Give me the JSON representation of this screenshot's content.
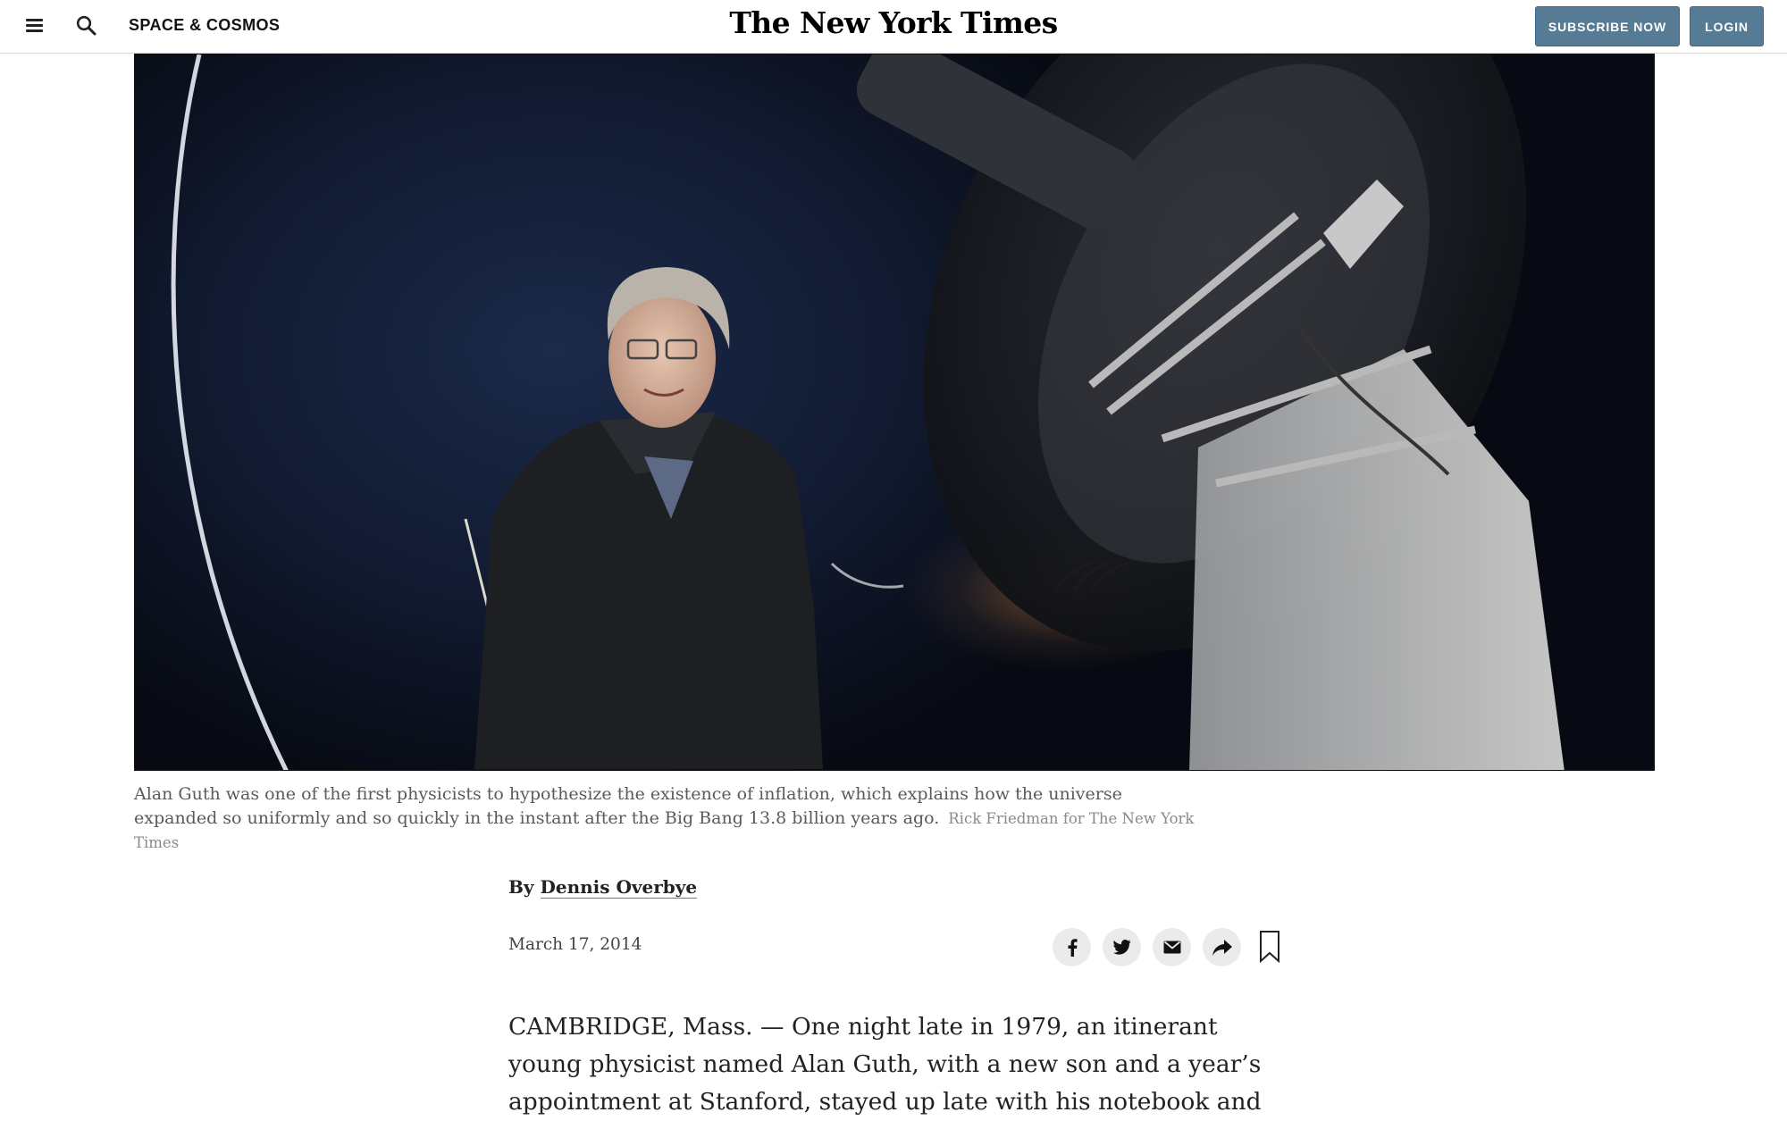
{
  "header": {
    "section": "SPACE & COSMOS",
    "logo": "The New York Times",
    "subscribe_label": "SUBSCRIBE NOW",
    "login_label": "LOGIN"
  },
  "photo": {
    "caption": "Alan Guth was one of the first physicists to hypothesize the existence of inflation, which explains how the universe expanded so uniformly and so quickly in the instant after the Big Bang 13.8 billion years ago.",
    "credit": "Rick Friedman for The New York Times"
  },
  "article": {
    "byline_prefix": "By",
    "author": "Dennis Overbye",
    "date": "March 17, 2014",
    "body": "CAMBRIDGE, Mass. — One night late in 1979, an itinerant young physicist named Alan Guth, with a new son and a year’s appointment at Stanford, stayed up late with his notebook and equations,"
  },
  "share": {
    "icons": [
      "facebook-icon",
      "twitter-icon",
      "email-icon",
      "share-more-icon",
      "bookmark-icon"
    ]
  },
  "colors": {
    "button_bg": "#567b95",
    "header_border": "#d7d7d7",
    "caption_text": "#5a5a5a",
    "credit_text": "#8a8a8a"
  }
}
